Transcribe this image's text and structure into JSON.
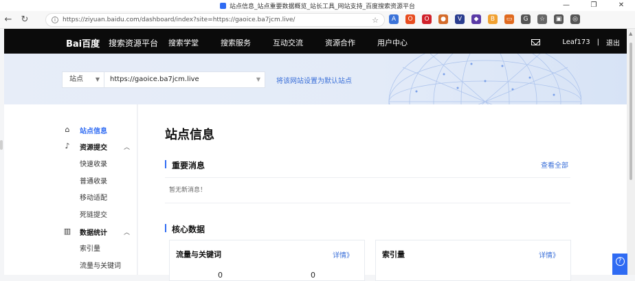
{
  "browser": {
    "tab_title": "站点信息_站点重要数据概览_站长工具_网站支持_百度搜索资源平台",
    "url": "https://ziyuan.baidu.com/dashboard/index?site=https://gaoice.ba7jcm.live/",
    "win_min": "—",
    "win_restore": "❐",
    "win_close": "✕",
    "back": "←",
    "forward": "→",
    "refresh": "↻",
    "star": "☆",
    "more": "…",
    "extensions": [
      {
        "label": "A",
        "color": "#3b73d9"
      },
      {
        "label": "O",
        "color": "#e74c1f"
      },
      {
        "label": "O",
        "color": "#d0202a"
      },
      {
        "label": "●",
        "color": "#d46b2a"
      },
      {
        "label": "V",
        "color": "#2a3d8f"
      },
      {
        "label": "◆",
        "color": "#5a3aa6"
      },
      {
        "label": "B",
        "color": "#f0a030"
      },
      {
        "label": "▭",
        "color": "#e06a1f"
      },
      {
        "label": "G",
        "color": "#555555"
      },
      {
        "label": "☆",
        "color": "#666666"
      },
      {
        "label": "▣",
        "color": "#555555"
      },
      {
        "label": "◎",
        "color": "#555555"
      }
    ]
  },
  "header": {
    "logo_bai": "Bai",
    "logo_du": "百度",
    "platform": "搜索资源平台",
    "nav": [
      "搜索学堂",
      "搜索服务",
      "互动交流",
      "资源合作",
      "用户中心"
    ],
    "username": "Leaf173",
    "separator": "|",
    "logout": "退出"
  },
  "banner": {
    "site_type": "站点",
    "site_url": "https://gaoice.ba7jcm.live",
    "set_default": "将该网站设置为默认站点"
  },
  "sidebar": {
    "items": [
      {
        "label": "站点信息",
        "icon": "home-icon",
        "glyph": "⌂",
        "active": true
      },
      {
        "label": "资源提交",
        "icon": "submit-icon",
        "glyph": "♪",
        "chevron": "︿"
      },
      {
        "label": "快速收录"
      },
      {
        "label": "普通收录"
      },
      {
        "label": "移动适配"
      },
      {
        "label": "死链提交"
      },
      {
        "label": "数据统计",
        "icon": "stats-icon",
        "glyph": "▥",
        "chevron": "︿"
      },
      {
        "label": "索引量"
      },
      {
        "label": "流量与关键词"
      }
    ]
  },
  "main": {
    "page_title": "站点信息",
    "important_msg": {
      "title": "重要消息",
      "view_all": "查看全部",
      "empty": "暂无新消息！"
    },
    "core_data": {
      "title": "核心数据",
      "cards": [
        {
          "title": "流量与关键词",
          "detail": "详情》",
          "values": [
            "0",
            "0"
          ]
        },
        {
          "title": "索引量",
          "detail": "详情》"
        }
      ]
    }
  }
}
